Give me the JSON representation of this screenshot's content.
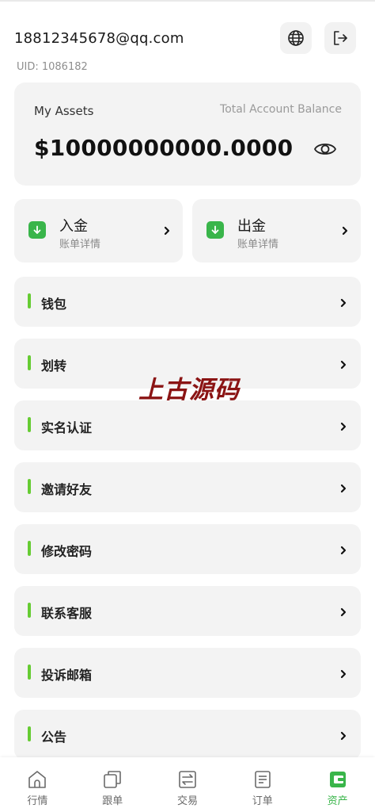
{
  "header": {
    "email": "18812345678@qq.com",
    "uid": "UID: 1086182",
    "globe_icon": "globe-icon",
    "logout_icon": "logout-icon"
  },
  "assets": {
    "title": "My Assets",
    "subtitle": "Total Account Balance",
    "amount": "$10000000000.0000",
    "eye_icon": "eye-icon"
  },
  "quick_actions": [
    {
      "title": "入金",
      "subtitle": "账单详情",
      "icon": "arrow-down-icon"
    },
    {
      "title": "出金",
      "subtitle": "账单详情",
      "icon": "arrow-down-icon"
    }
  ],
  "menu": [
    {
      "label": "钱包"
    },
    {
      "label": "划转"
    },
    {
      "label": "实名认证"
    },
    {
      "label": "邀请好友"
    },
    {
      "label": "修改密码"
    },
    {
      "label": "联系客服"
    },
    {
      "label": "投诉邮箱"
    },
    {
      "label": "公告"
    }
  ],
  "watermark": "上古源码",
  "tabbar": [
    {
      "label": "行情",
      "icon": "home-icon",
      "active": false
    },
    {
      "label": "跟单",
      "icon": "copy-icon",
      "active": false
    },
    {
      "label": "交易",
      "icon": "exchange-icon",
      "active": false
    },
    {
      "label": "订单",
      "icon": "orders-icon",
      "active": false
    },
    {
      "label": "资产",
      "icon": "wallet-icon",
      "active": true
    }
  ],
  "colors": {
    "accent_green": "#39b54a",
    "menu_bar_green": "#66cc33",
    "watermark_red": "#8b1414",
    "card_bg": "#f3f3f3"
  }
}
